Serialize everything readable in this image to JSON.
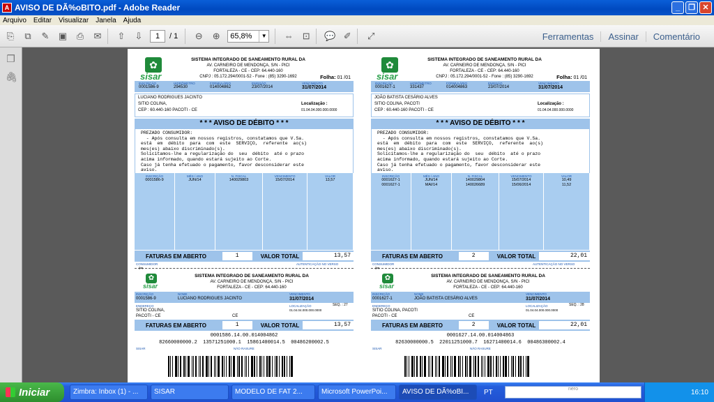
{
  "window": {
    "title": "AVISO DE DÃ%oBITO.pdf - Adobe Reader"
  },
  "menu": [
    "Arquivo",
    "Editar",
    "Visualizar",
    "Janela",
    "Ajuda"
  ],
  "toolbar": {
    "page_current": "1",
    "page_total": "/ 1",
    "zoom": "65,8%",
    "links": [
      "Ferramentas",
      "Assinar",
      "Comentário"
    ]
  },
  "bills": [
    {
      "org": "SISTEMA INTEGRADO DE SANEAMENTO RURAL DA",
      "street": "AV. CARNEIRO DE MENDONÇA, S/N - PICI",
      "city": "FORTALEZA - CE - CEP: 64.440-160",
      "cnpj": "CNPJ : 05.172.294/0001-52 - Fone : (85) 3290-1692",
      "folha_label": "Folha:",
      "folha": "01 /01",
      "h_labels": [
        "INSCRIÇÃO",
        "HIDRÔMETRO",
        "FORMULÁRIO",
        "EMISSÃO",
        "VENCIMENTO"
      ],
      "inscricao": "0001586-9",
      "hidrometro": "294530",
      "formulario": "014004862",
      "emissao": "23/07/2014",
      "vencimento": "31/07/2014",
      "name": "LUCIANO RODRIGUES JACINTO",
      "addr1": "SITIO COLINA,",
      "addr2": "CEP : 60.440-160  PACOTI - CE",
      "loc_label": "Localização :",
      "loc": "01.04.04.000.000.0000",
      "aviso": "* * * AVISO DE DÉBITO * * *",
      "msg": [
        "PREZADO CONSUMIDOR:",
        "  - Após consulta em nossos registros, constatamos que V.Sa.",
        "está  em  débito  para  com  este  SERVIÇO,  referente  ao(s)",
        "mes(es) abaixo discriminado(s).",
        "Solicitamos-lhe a regularização do  seu  débito  até o prazo",
        "acima informado, quando estará sujeito ao Corte.",
        "Caso já tenha efetuado o pagamento, favor desconsiderar este",
        "aviso."
      ],
      "cols": [
        "INSCRIÇÃO",
        "MÊS / ANO",
        "N. FISCAL",
        "VENCIMENTO",
        "VALOR"
      ],
      "rows": [
        [
          "0001586-9",
          "JUN/14",
          "140029803",
          "15/07/2014",
          "13,57"
        ]
      ],
      "fat_label": "FATURAS EM ABERTO",
      "fat": "1",
      "vt_label": "VALOR TOTAL",
      "vt": "13,57",
      "consumidor": "CONSUMIDOR",
      "autent": "AUTENTICAÇÃO NO VERSO",
      "s_labels": [
        "INSCRIÇÃO",
        "NOME",
        "VENCIMENTO"
      ],
      "s_name": "LUCIANO RODRIGUES JACINTO",
      "endereco": "ENDEREÇO",
      "s_loc_label": "LOCALIZAÇÃO",
      "seq": "SEQ. : 27",
      "s_addr1": "SITIO COLINA,",
      "s_addr2": "PACOTI - CE",
      "ce": "CE",
      "code": "0001586.14.00.014004862",
      "digits": "82660000000.2  13571251000.1  15861400014.5  00486200002.5",
      "sisar": "SISAR",
      "nao": "NÃO RASURE"
    },
    {
      "org": "SISTEMA INTEGRADO DE SANEAMENTO RURAL DA",
      "street": "AV. CARNEIRO DE MENDONÇA, S/N - PICI",
      "city": "FORTALEZA - CE - CEP: 64.440-160",
      "cnpj": "CNPJ : 05.172.294/0001-52 - Fone : (85) 3290-1692",
      "folha_label": "Folha:",
      "folha": "01 /01",
      "h_labels": [
        "INSCRIÇÃO",
        "HIDRÔMETRO",
        "FORMULÁRIO",
        "EMISSÃO",
        "VENCIMENTO"
      ],
      "inscricao": "0001627-1",
      "hidrometro": "331437",
      "formulario": "014004863",
      "emissao": "23/07/2014",
      "vencimento": "31/07/2014",
      "name": "JOÃO BATISTA CESÁRIO ALVES",
      "addr1": "SITIO COLINA,  PACOTI",
      "addr2": "CEP : 60.440-160  PACOTI - CE",
      "loc_label": "Localização :",
      "loc": "01.04.04.000.000.0000",
      "aviso": "* * * AVISO DE DÉBITO * * *",
      "msg": [
        "PREZADO CONSUMIDOR:",
        "  - Após consulta em nossos registros, constatamos que V.Sa.",
        "está  em  débito  para  com  este  SERVIÇO,  referente  ao(s)",
        "mes(es) abaixo discriminado(s).",
        "Solicitamos-lhe a regularização do  seu  débito  até o prazo",
        "acima informado, quando estará sujeito ao Corte.",
        "Caso já tenha efetuado o pagamento, favor desconsiderar este",
        "aviso."
      ],
      "cols": [
        "INSCRIÇÃO",
        "MÊS / ANO",
        "N. FISCAL",
        "VENCIMENTO",
        "VALOR"
      ],
      "rows": [
        [
          "0001627-1",
          "JUN/14",
          "140029804",
          "15/07/2014",
          "10,49"
        ],
        [
          "0001627-1",
          "MAI/14",
          "140026689",
          "15/06/2014",
          "11,52"
        ]
      ],
      "fat_label": "FATURAS EM ABERTO",
      "fat": "2",
      "vt_label": "VALOR TOTAL",
      "vt": "22,01",
      "consumidor": "CONSUMIDOR",
      "autent": "AUTENTICAÇÃO NO VERSO",
      "s_labels": [
        "INSCRIÇÃO",
        "NOME",
        "VENCIMENTO"
      ],
      "s_name": "JOÃO BATISTA CESÁRIO ALVES",
      "endereco": "ENDEREÇO",
      "s_loc_label": "LOCALIZAÇÃO",
      "seq": "SEQ. : 28",
      "s_addr1": "SITIO COLINA,  PACOTI",
      "s_addr2": "PACOTI - CE",
      "ce": "CE",
      "code": "0001627.14.00.014004863",
      "digits": "82630000000.5  22011251000.7  16271400014.6  00486300002.4",
      "sisar": "SISAR",
      "nao": "NÃO RASURE"
    }
  ],
  "taskbar": {
    "start": "Iniciar",
    "tasks": [
      "Zimbra: Inbox (1) - ...",
      "SISAR",
      "MODELO DE FAT 2...",
      "Microsoft PowerPoi...",
      "AVISO DE DÃ%oBI..."
    ],
    "lang": "PT",
    "search_brand": "nero",
    "clock": "16:10"
  }
}
